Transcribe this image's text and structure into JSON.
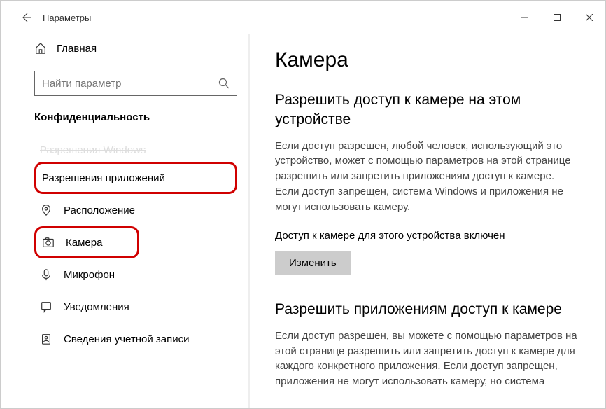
{
  "window_title": "Параметры",
  "sidebar": {
    "home": "Главная",
    "search_placeholder": "Найти параметр",
    "category": "Конфиденциальность",
    "faded": "Разрешения Windows",
    "header_app_perms": "Разрешения приложений",
    "items": {
      "location": "Расположение",
      "camera": "Камера",
      "microphone": "Микрофон",
      "notifications": "Уведомления",
      "account_info": "Сведения учетной записи"
    }
  },
  "main": {
    "title": "Камера",
    "section1": {
      "heading": "Разрешить доступ к камере на этом устройстве",
      "desc": "Если доступ разрешен, любой человек, использующий это устройство, может с помощью параметров на этой странице разрешить или запретить приложениям доступ к камере. Если доступ запрещен, система Windows и приложения не могут использовать камеру.",
      "status": "Доступ к камере для этого устройства включен",
      "button": "Изменить"
    },
    "section2": {
      "heading": "Разрешить приложениям доступ к камере",
      "desc": "Если доступ разрешен, вы можете с помощью параметров на этой странице разрешить или запретить доступ к камере для каждого конкретного приложения. Если доступ запрещен, приложения не могут использовать камеру, но система"
    }
  }
}
